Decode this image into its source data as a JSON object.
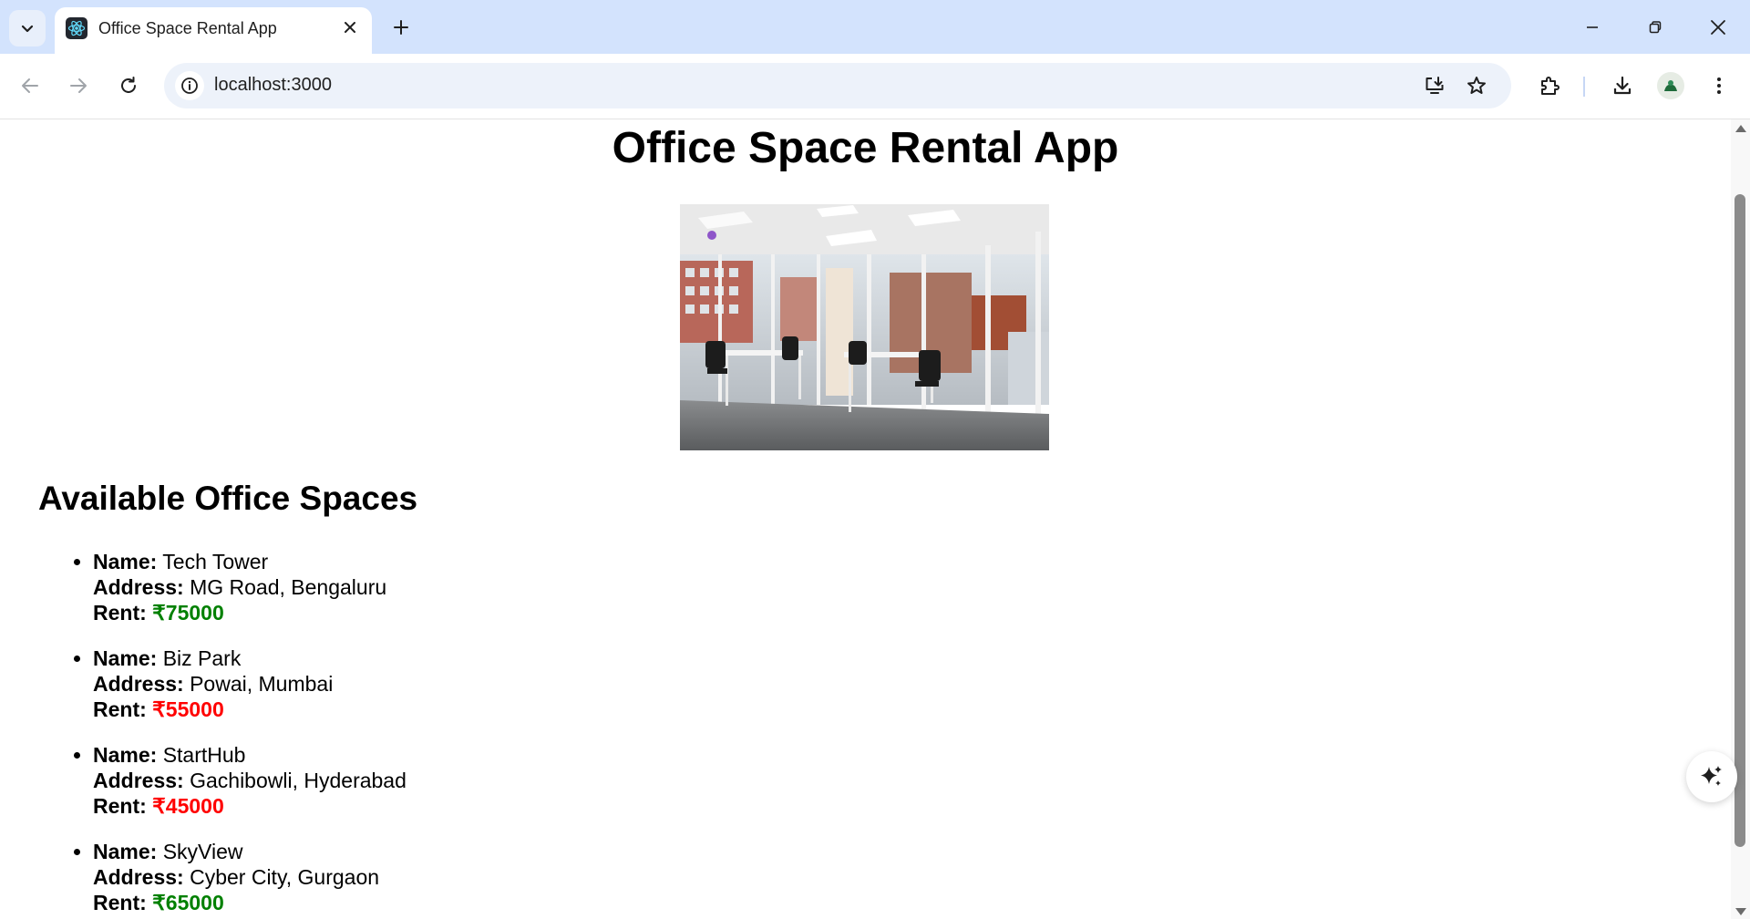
{
  "browser": {
    "tab_title": "Office Space Rental App",
    "url": "localhost:3000"
  },
  "page": {
    "title": "Office Space Rental App",
    "section_title": "Available Office Spaces",
    "labels": {
      "name": "Name:",
      "address": "Address:",
      "rent": "Rent:"
    },
    "rent_colors": {
      "high": "#008000",
      "low": "#ff0000"
    },
    "spaces": [
      {
        "name": "Tech Tower",
        "address": "MG Road, Bengaluru",
        "rent": "₹75000",
        "rent_color": "#008000"
      },
      {
        "name": "Biz Park",
        "address": "Powai, Mumbai",
        "rent": "₹55000",
        "rent_color": "#ff0000"
      },
      {
        "name": "StartHub",
        "address": "Gachibowli, Hyderabad",
        "rent": "₹45000",
        "rent_color": "#ff0000"
      },
      {
        "name": "SkyView",
        "address": "Cyber City, Gurgaon",
        "rent": "₹65000",
        "rent_color": "#008000"
      }
    ]
  },
  "icons": {
    "tab_search": "chevron-down-icon",
    "favicon": "react-icon",
    "close": "close-icon",
    "new_tab": "plus-icon",
    "back": "back-arrow-icon",
    "forward": "forward-arrow-icon",
    "reload": "reload-icon",
    "site_info": "info-icon",
    "install": "install-app-icon",
    "bookmark": "star-icon",
    "extensions": "puzzle-icon",
    "downloads": "download-icon",
    "menu": "kebab-menu-icon",
    "ai": "sparkle-icon"
  }
}
